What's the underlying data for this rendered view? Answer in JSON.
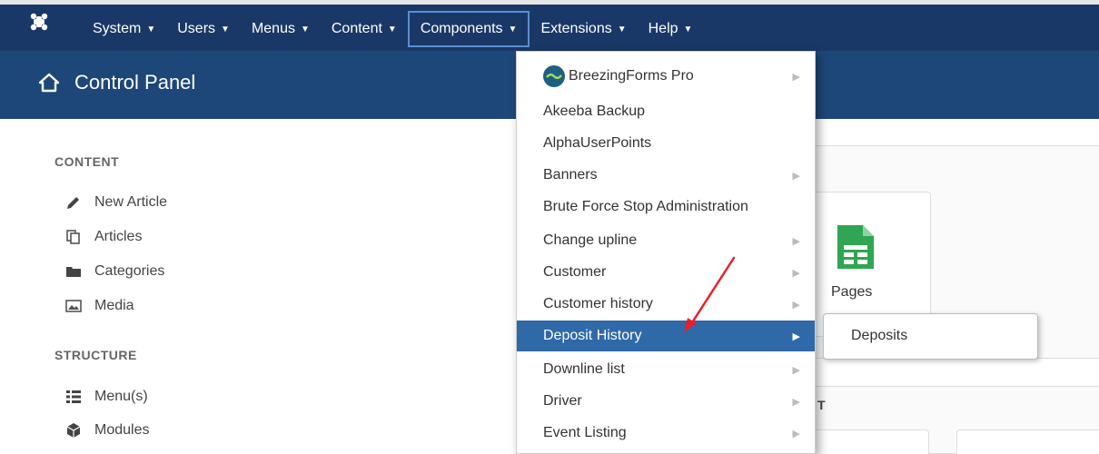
{
  "navbar": {
    "items": [
      {
        "label": "System"
      },
      {
        "label": "Users"
      },
      {
        "label": "Menus"
      },
      {
        "label": "Content"
      },
      {
        "label": "Components"
      },
      {
        "label": "Extensions"
      },
      {
        "label": "Help"
      }
    ],
    "brand_icon": "joomla-icon"
  },
  "header": {
    "title": "Control Panel",
    "icon": "home-icon"
  },
  "sidebar": {
    "content_title": "CONTENT",
    "content_items": [
      {
        "label": "New Article",
        "icon": "pencil-icon"
      },
      {
        "label": "Articles",
        "icon": "copy-icon"
      },
      {
        "label": "Categories",
        "icon": "folder-icon"
      },
      {
        "label": "Media",
        "icon": "image-icon"
      }
    ],
    "structure_title": "STRUCTURE",
    "structure_items": [
      {
        "label": "Menu(s)",
        "icon": "list-icon"
      },
      {
        "label": "Modules",
        "icon": "cube-icon"
      }
    ]
  },
  "panels": {
    "pages_label": "Pages",
    "bottom_letter": "T"
  },
  "components_menu": {
    "items": [
      {
        "label": "BreezingForms Pro"
      },
      {
        "label": "Akeeba Backup"
      },
      {
        "label": "AlphaUserPoints"
      },
      {
        "label": "Banners"
      },
      {
        "label": "Brute Force Stop Administration"
      },
      {
        "label": "Change upline"
      },
      {
        "label": "Customer"
      },
      {
        "label": "Customer history"
      },
      {
        "label": "Deposit History"
      },
      {
        "label": "Downline list"
      },
      {
        "label": "Driver"
      },
      {
        "label": "Event Listing"
      }
    ]
  },
  "submenu": {
    "item": "Deposits"
  },
  "colors": {
    "navbar": "#1a3867",
    "header": "#1e4779",
    "highlight": "#2f69a8",
    "arrow": "#e8202a"
  }
}
